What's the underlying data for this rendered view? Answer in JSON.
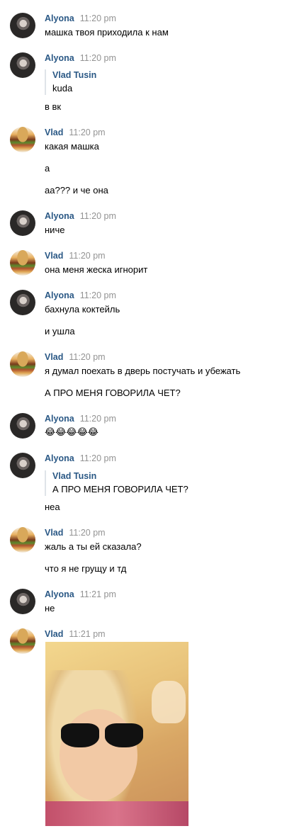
{
  "names": {
    "alyona": "Alyona",
    "vlad": "Vlad",
    "vlad_full": "Vlad Tusin"
  },
  "messages": [
    {
      "time": "11:20 pm",
      "lines": [
        "машка твоя приходила к нам"
      ]
    },
    {
      "time": "11:20 pm",
      "quote": "kuda",
      "lines": [
        "в вк"
      ]
    },
    {
      "time": "11:20 pm",
      "lines": [
        "какая машка",
        "а",
        "аа??? и че она"
      ]
    },
    {
      "time": "11:20 pm",
      "lines": [
        "ниче"
      ]
    },
    {
      "time": "11:20 pm",
      "lines": [
        "она меня жеска игнорит"
      ]
    },
    {
      "time": "11:20 pm",
      "lines": [
        "бахнула коктейль",
        "и ушла"
      ]
    },
    {
      "time": "11:20 pm",
      "lines": [
        "я думал поехать в дверь постучать и убежать",
        "А ПРО МЕНЯ ГОВОРИЛА ЧЕТ?"
      ]
    },
    {
      "time": "11:20 pm",
      "lines": [
        "😂😂😂😂😂"
      ]
    },
    {
      "time": "11:20 pm",
      "quote": "А ПРО МЕНЯ ГОВОРИЛА ЧЕТ?",
      "lines": [
        "неа"
      ]
    },
    {
      "time": "11:20 pm",
      "lines": [
        "жаль а ты ей сказала?",
        "что я не грущу и тд"
      ]
    },
    {
      "time": "11:21 pm",
      "lines": [
        "не"
      ]
    },
    {
      "time": "11:21 pm",
      "photo": true
    }
  ]
}
